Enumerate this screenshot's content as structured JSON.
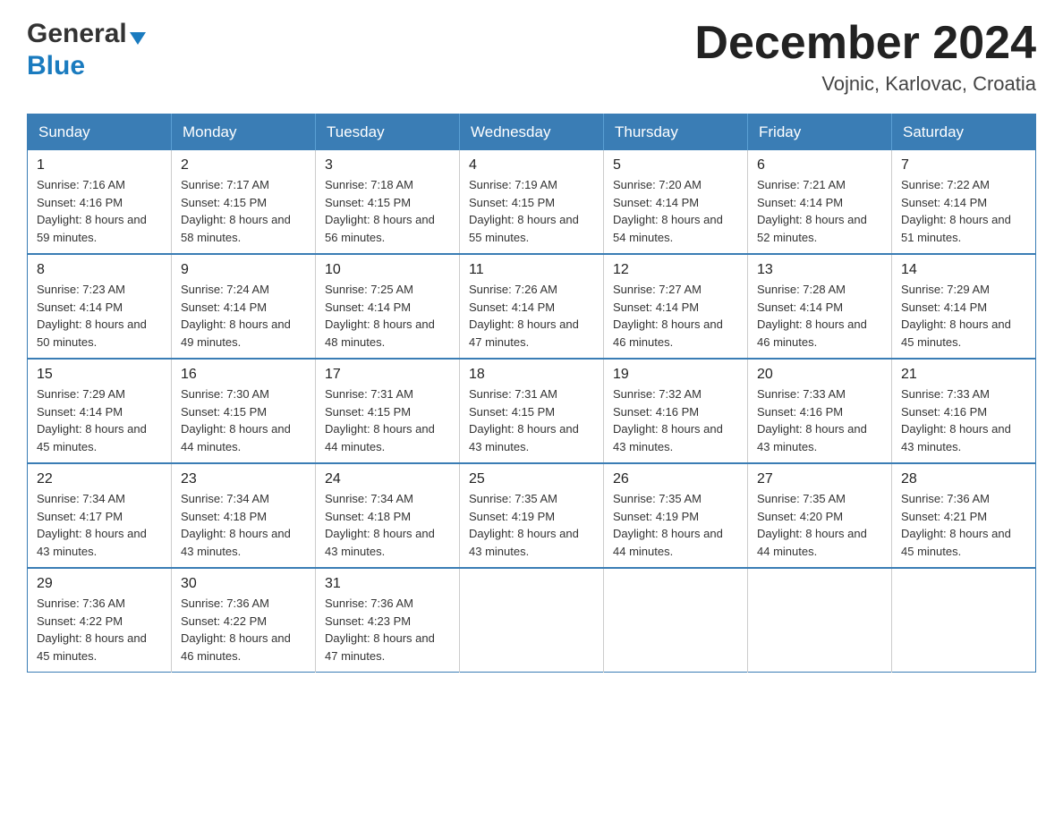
{
  "header": {
    "month_title": "December 2024",
    "location": "Vojnic, Karlovac, Croatia",
    "logo_general": "General",
    "logo_blue": "Blue"
  },
  "calendar": {
    "days_of_week": [
      "Sunday",
      "Monday",
      "Tuesday",
      "Wednesday",
      "Thursday",
      "Friday",
      "Saturday"
    ],
    "weeks": [
      [
        {
          "day": "1",
          "sunrise": "Sunrise: 7:16 AM",
          "sunset": "Sunset: 4:16 PM",
          "daylight": "Daylight: 8 hours and 59 minutes."
        },
        {
          "day": "2",
          "sunrise": "Sunrise: 7:17 AM",
          "sunset": "Sunset: 4:15 PM",
          "daylight": "Daylight: 8 hours and 58 minutes."
        },
        {
          "day": "3",
          "sunrise": "Sunrise: 7:18 AM",
          "sunset": "Sunset: 4:15 PM",
          "daylight": "Daylight: 8 hours and 56 minutes."
        },
        {
          "day": "4",
          "sunrise": "Sunrise: 7:19 AM",
          "sunset": "Sunset: 4:15 PM",
          "daylight": "Daylight: 8 hours and 55 minutes."
        },
        {
          "day": "5",
          "sunrise": "Sunrise: 7:20 AM",
          "sunset": "Sunset: 4:14 PM",
          "daylight": "Daylight: 8 hours and 54 minutes."
        },
        {
          "day": "6",
          "sunrise": "Sunrise: 7:21 AM",
          "sunset": "Sunset: 4:14 PM",
          "daylight": "Daylight: 8 hours and 52 minutes."
        },
        {
          "day": "7",
          "sunrise": "Sunrise: 7:22 AM",
          "sunset": "Sunset: 4:14 PM",
          "daylight": "Daylight: 8 hours and 51 minutes."
        }
      ],
      [
        {
          "day": "8",
          "sunrise": "Sunrise: 7:23 AM",
          "sunset": "Sunset: 4:14 PM",
          "daylight": "Daylight: 8 hours and 50 minutes."
        },
        {
          "day": "9",
          "sunrise": "Sunrise: 7:24 AM",
          "sunset": "Sunset: 4:14 PM",
          "daylight": "Daylight: 8 hours and 49 minutes."
        },
        {
          "day": "10",
          "sunrise": "Sunrise: 7:25 AM",
          "sunset": "Sunset: 4:14 PM",
          "daylight": "Daylight: 8 hours and 48 minutes."
        },
        {
          "day": "11",
          "sunrise": "Sunrise: 7:26 AM",
          "sunset": "Sunset: 4:14 PM",
          "daylight": "Daylight: 8 hours and 47 minutes."
        },
        {
          "day": "12",
          "sunrise": "Sunrise: 7:27 AM",
          "sunset": "Sunset: 4:14 PM",
          "daylight": "Daylight: 8 hours and 46 minutes."
        },
        {
          "day": "13",
          "sunrise": "Sunrise: 7:28 AM",
          "sunset": "Sunset: 4:14 PM",
          "daylight": "Daylight: 8 hours and 46 minutes."
        },
        {
          "day": "14",
          "sunrise": "Sunrise: 7:29 AM",
          "sunset": "Sunset: 4:14 PM",
          "daylight": "Daylight: 8 hours and 45 minutes."
        }
      ],
      [
        {
          "day": "15",
          "sunrise": "Sunrise: 7:29 AM",
          "sunset": "Sunset: 4:14 PM",
          "daylight": "Daylight: 8 hours and 45 minutes."
        },
        {
          "day": "16",
          "sunrise": "Sunrise: 7:30 AM",
          "sunset": "Sunset: 4:15 PM",
          "daylight": "Daylight: 8 hours and 44 minutes."
        },
        {
          "day": "17",
          "sunrise": "Sunrise: 7:31 AM",
          "sunset": "Sunset: 4:15 PM",
          "daylight": "Daylight: 8 hours and 44 minutes."
        },
        {
          "day": "18",
          "sunrise": "Sunrise: 7:31 AM",
          "sunset": "Sunset: 4:15 PM",
          "daylight": "Daylight: 8 hours and 43 minutes."
        },
        {
          "day": "19",
          "sunrise": "Sunrise: 7:32 AM",
          "sunset": "Sunset: 4:16 PM",
          "daylight": "Daylight: 8 hours and 43 minutes."
        },
        {
          "day": "20",
          "sunrise": "Sunrise: 7:33 AM",
          "sunset": "Sunset: 4:16 PM",
          "daylight": "Daylight: 8 hours and 43 minutes."
        },
        {
          "day": "21",
          "sunrise": "Sunrise: 7:33 AM",
          "sunset": "Sunset: 4:16 PM",
          "daylight": "Daylight: 8 hours and 43 minutes."
        }
      ],
      [
        {
          "day": "22",
          "sunrise": "Sunrise: 7:34 AM",
          "sunset": "Sunset: 4:17 PM",
          "daylight": "Daylight: 8 hours and 43 minutes."
        },
        {
          "day": "23",
          "sunrise": "Sunrise: 7:34 AM",
          "sunset": "Sunset: 4:18 PM",
          "daylight": "Daylight: 8 hours and 43 minutes."
        },
        {
          "day": "24",
          "sunrise": "Sunrise: 7:34 AM",
          "sunset": "Sunset: 4:18 PM",
          "daylight": "Daylight: 8 hours and 43 minutes."
        },
        {
          "day": "25",
          "sunrise": "Sunrise: 7:35 AM",
          "sunset": "Sunset: 4:19 PM",
          "daylight": "Daylight: 8 hours and 43 minutes."
        },
        {
          "day": "26",
          "sunrise": "Sunrise: 7:35 AM",
          "sunset": "Sunset: 4:19 PM",
          "daylight": "Daylight: 8 hours and 44 minutes."
        },
        {
          "day": "27",
          "sunrise": "Sunrise: 7:35 AM",
          "sunset": "Sunset: 4:20 PM",
          "daylight": "Daylight: 8 hours and 44 minutes."
        },
        {
          "day": "28",
          "sunrise": "Sunrise: 7:36 AM",
          "sunset": "Sunset: 4:21 PM",
          "daylight": "Daylight: 8 hours and 45 minutes."
        }
      ],
      [
        {
          "day": "29",
          "sunrise": "Sunrise: 7:36 AM",
          "sunset": "Sunset: 4:22 PM",
          "daylight": "Daylight: 8 hours and 45 minutes."
        },
        {
          "day": "30",
          "sunrise": "Sunrise: 7:36 AM",
          "sunset": "Sunset: 4:22 PM",
          "daylight": "Daylight: 8 hours and 46 minutes."
        },
        {
          "day": "31",
          "sunrise": "Sunrise: 7:36 AM",
          "sunset": "Sunset: 4:23 PM",
          "daylight": "Daylight: 8 hours and 47 minutes."
        },
        null,
        null,
        null,
        null
      ]
    ]
  }
}
